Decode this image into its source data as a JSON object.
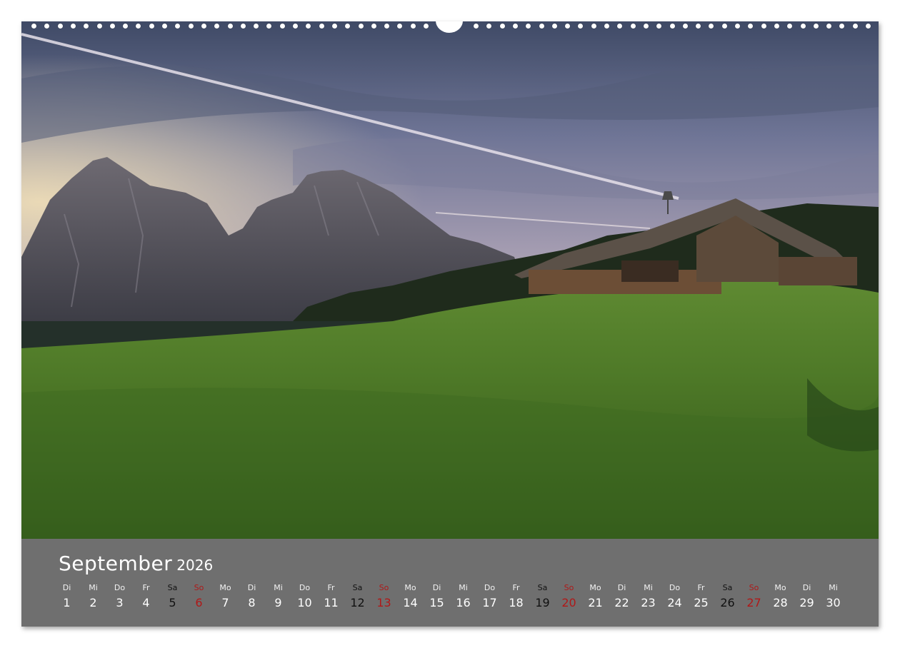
{
  "calendar": {
    "month": "September",
    "year": "2026",
    "days": [
      {
        "wd": "Di",
        "d": "1",
        "kind": "weekday"
      },
      {
        "wd": "Mi",
        "d": "2",
        "kind": "weekday"
      },
      {
        "wd": "Do",
        "d": "3",
        "kind": "weekday"
      },
      {
        "wd": "Fr",
        "d": "4",
        "kind": "weekday"
      },
      {
        "wd": "Sa",
        "d": "5",
        "kind": "saturday"
      },
      {
        "wd": "So",
        "d": "6",
        "kind": "sunday"
      },
      {
        "wd": "Mo",
        "d": "7",
        "kind": "weekday"
      },
      {
        "wd": "Di",
        "d": "8",
        "kind": "weekday"
      },
      {
        "wd": "Mi",
        "d": "9",
        "kind": "weekday"
      },
      {
        "wd": "Do",
        "d": "10",
        "kind": "weekday"
      },
      {
        "wd": "Fr",
        "d": "11",
        "kind": "weekday"
      },
      {
        "wd": "Sa",
        "d": "12",
        "kind": "saturday"
      },
      {
        "wd": "So",
        "d": "13",
        "kind": "sunday"
      },
      {
        "wd": "Mo",
        "d": "14",
        "kind": "weekday"
      },
      {
        "wd": "Di",
        "d": "15",
        "kind": "weekday"
      },
      {
        "wd": "Mi",
        "d": "16",
        "kind": "weekday"
      },
      {
        "wd": "Do",
        "d": "17",
        "kind": "weekday"
      },
      {
        "wd": "Fr",
        "d": "18",
        "kind": "weekday"
      },
      {
        "wd": "Sa",
        "d": "19",
        "kind": "saturday"
      },
      {
        "wd": "So",
        "d": "20",
        "kind": "sunday"
      },
      {
        "wd": "Mo",
        "d": "21",
        "kind": "weekday"
      },
      {
        "wd": "Di",
        "d": "22",
        "kind": "weekday"
      },
      {
        "wd": "Mi",
        "d": "23",
        "kind": "weekday"
      },
      {
        "wd": "Do",
        "d": "24",
        "kind": "weekday"
      },
      {
        "wd": "Fr",
        "d": "25",
        "kind": "weekday"
      },
      {
        "wd": "Sa",
        "d": "26",
        "kind": "saturday"
      },
      {
        "wd": "So",
        "d": "27",
        "kind": "sunday"
      },
      {
        "wd": "Mo",
        "d": "28",
        "kind": "weekday"
      },
      {
        "wd": "Di",
        "d": "29",
        "kind": "weekday"
      },
      {
        "wd": "Mi",
        "d": "30",
        "kind": "weekday"
      }
    ]
  },
  "colors": {
    "calendar_bar": "#6f6f6f",
    "sunday": "#b01818",
    "saturday": "#111111",
    "weekday": "#ffffff"
  },
  "photo": {
    "subject": "landscape-photo"
  }
}
